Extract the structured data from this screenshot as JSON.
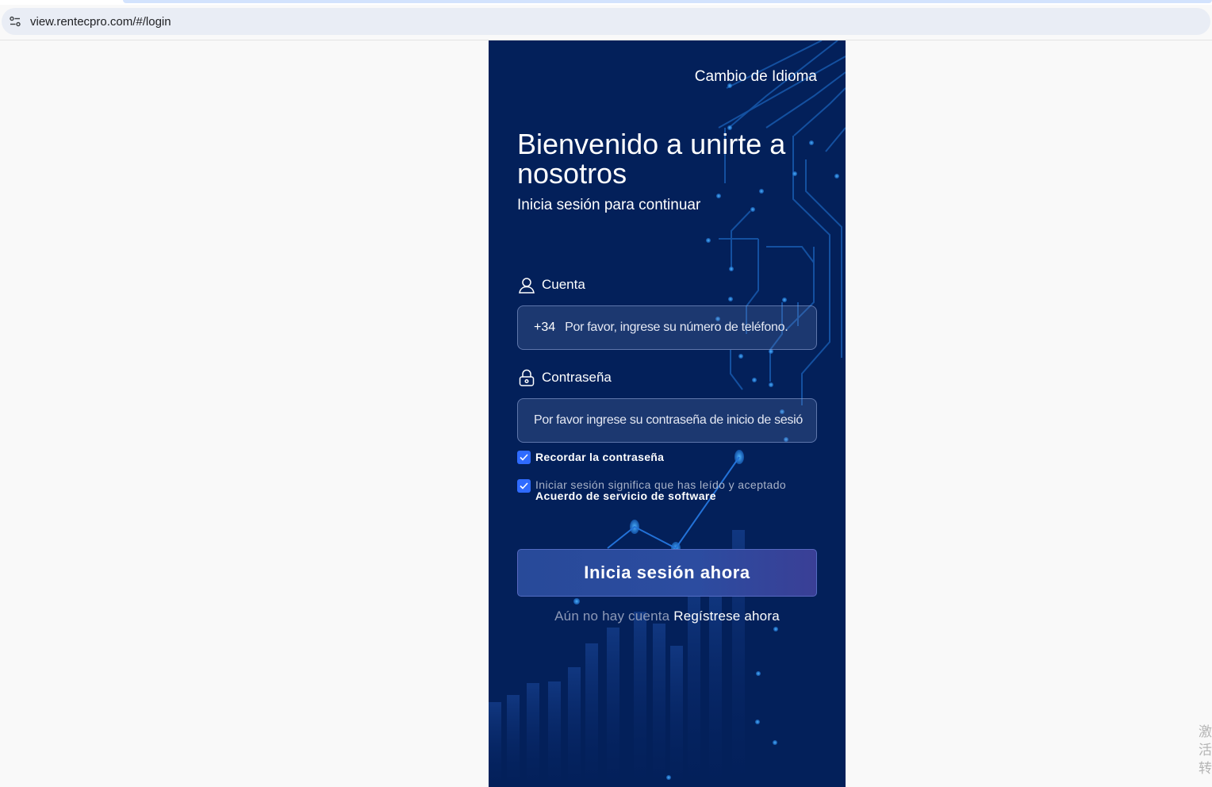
{
  "browser": {
    "url": "view.rentecpro.com/#/login",
    "site_info_icon": "tune-icon"
  },
  "login": {
    "language_switch": "Cambio de Idioma",
    "welcome_title": "Bienvenido a unirte a nosotros",
    "subtitle": "Inicia sesión para continuar",
    "account": {
      "label": "Cuenta",
      "icon": "user-icon",
      "country_code": "+34",
      "placeholder": "Por favor, ingrese su número de teléfono."
    },
    "password": {
      "label": "Contraseña",
      "icon": "lock-icon",
      "placeholder": "Por favor ingrese su contraseña de inicio de sesión"
    },
    "remember": {
      "label": "Recordar la contraseña",
      "checked": true
    },
    "agreement": {
      "text": "Iniciar sesión significa que has leído y aceptado",
      "link": "Acuerdo de servicio de software",
      "checked": true
    },
    "submit_label": "Inicia sesión ahora",
    "register_prompt": "Aún no hay cuenta",
    "register_link": "Regístrese ahora"
  },
  "colors": {
    "panel_background": "#03205a",
    "button_start": "#284a99",
    "button_end": "#3a3f96",
    "checkbox": "#2f6bff"
  },
  "corner_text": "激活转"
}
